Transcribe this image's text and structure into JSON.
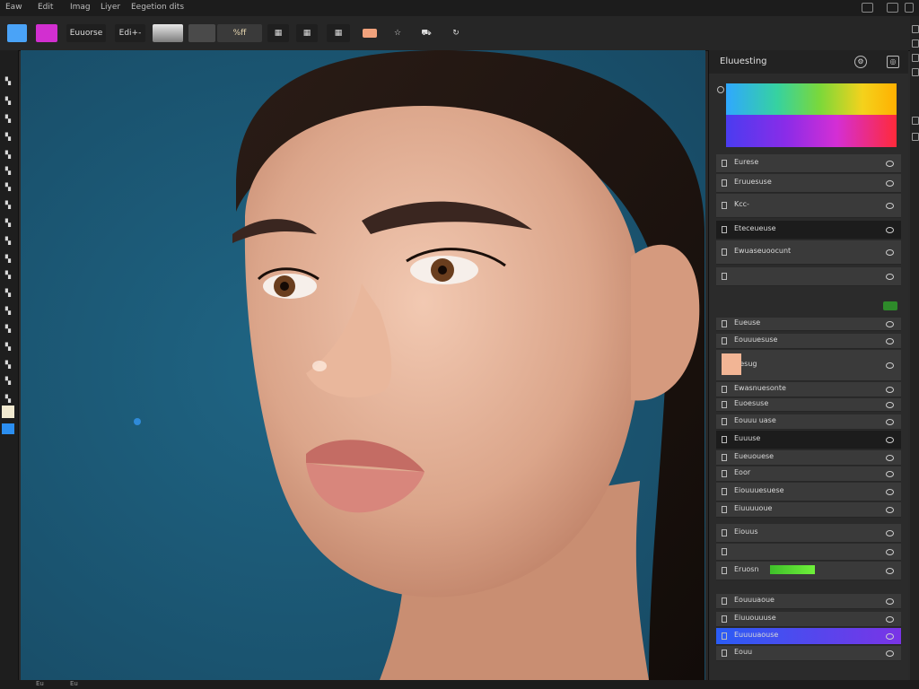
{
  "menu": {
    "items": [
      "Eaw",
      "Edit",
      "Imag",
      "Liyer",
      "Eegetion dits"
    ]
  },
  "options_bar": {
    "mode_label": "Euuorse",
    "edit_label": "Edi+-",
    "percent_label": "%ff"
  },
  "colors": {
    "foreground": "#4aa3f7",
    "secondary": "#d22fd0",
    "canvas_bg": "#1f5a78",
    "panel_bg": "#2b2b2b",
    "accent_green": "#6ff03a",
    "selected_row_start": "#2a5cf5",
    "selected_row_end": "#7a34e6"
  },
  "panel": {
    "title": "Eluuesting",
    "rows": [
      {
        "label": "Eurese",
        "style": "normal"
      },
      {
        "label": "Eruuesuse",
        "style": "normal"
      },
      {
        "label": "Kcc-",
        "style": "normal"
      },
      {
        "label": "Eteceueuse",
        "style": "dark"
      },
      {
        "label": "Ewuaseuoocunt",
        "style": "normal"
      },
      {
        "label": "",
        "style": "normal"
      },
      {
        "label": "Eueuse",
        "style": "normal"
      },
      {
        "label": "Eouuuesuse",
        "style": "normal"
      },
      {
        "label": "Fiesug",
        "style": "normal"
      },
      {
        "label": "Ewasnuesonte",
        "style": "normal"
      },
      {
        "label": "Euoesuse",
        "style": "normal"
      },
      {
        "label": "Eouuu uase",
        "style": "normal"
      },
      {
        "label": "Euuuse",
        "style": "dark"
      },
      {
        "label": "Eueuouese",
        "style": "normal"
      },
      {
        "label": "Eoor",
        "style": "normal"
      },
      {
        "label": "Eiouuuesuese",
        "style": "normal"
      },
      {
        "label": "Eiuuuuoue",
        "style": "normal"
      },
      {
        "label": "Eiouus",
        "style": "normal"
      },
      {
        "label": "",
        "style": "normal"
      },
      {
        "label": "Eruosn",
        "style": "normal"
      },
      {
        "label": "Eouuuaoue",
        "style": "normal"
      },
      {
        "label": "Eiuuouuuse",
        "style": "normal"
      },
      {
        "label": "Euuuuaouse",
        "style": "selected"
      },
      {
        "label": "Eouu",
        "style": "normal"
      }
    ]
  },
  "status": {
    "items": [
      "Eu",
      "Eu"
    ]
  },
  "tools": [
    "move-tool",
    "marquee-tool",
    "lasso-tool",
    "crop-tool",
    "eyedropper-tool",
    "healing-tool",
    "brush-tool",
    "stamp-tool",
    "history-tool",
    "eraser-tool",
    "gradient-tool",
    "blur-tool",
    "dodge-tool",
    "pen-tool",
    "type-tool",
    "path-tool",
    "shape-tool",
    "hand-tool",
    "zoom-tool"
  ]
}
